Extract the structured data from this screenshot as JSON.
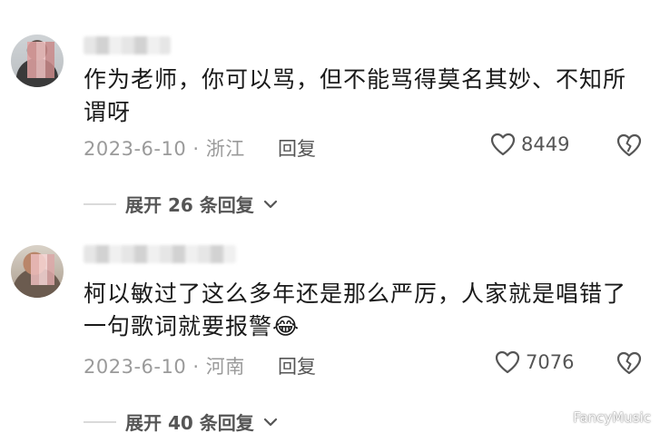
{
  "comments": [
    {
      "username": "",
      "text": "作为老师，你可以骂，但不能骂得莫名其妙、不知所谓呀",
      "date_location": "2023-6-10 · 浙江",
      "reply_label": "回复",
      "likes": "8449",
      "expand_label": "展开 26 条回复"
    },
    {
      "username": "",
      "text": "柯以敏过了这么多年还是那么严厉，人家就是唱错了一句歌词就要报警",
      "emoji": "😂",
      "date_location": "2023-6-10 · 河南",
      "reply_label": "回复",
      "likes": "7076",
      "expand_label": "展开 40 条回复"
    }
  ],
  "watermark": "FancyMusic",
  "icons": {
    "like": "heart-outline-icon",
    "dislike": "broken-heart-icon",
    "expand": "chevron-down-icon"
  },
  "colors": {
    "text": "#1a1a1a",
    "meta": "#9a9a9a",
    "action": "#555555"
  }
}
